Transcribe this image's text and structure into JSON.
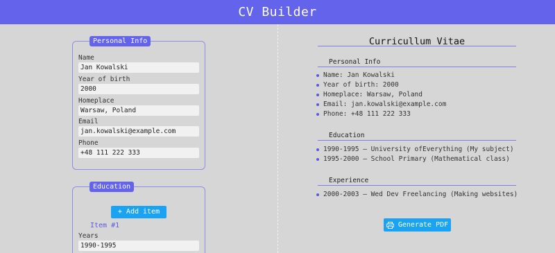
{
  "app": {
    "title": "CV Builder"
  },
  "form": {
    "personal": {
      "legend": "Personal Info",
      "fields": [
        {
          "label": "Name",
          "value": "Jan Kowalski"
        },
        {
          "label": "Year of birth",
          "value": "2000"
        },
        {
          "label": "Homeplace",
          "value": "Warsaw, Poland"
        },
        {
          "label": "Email",
          "value": "jan.kowalski@example.com"
        },
        {
          "label": "Phone",
          "value": "+48 111 222 333"
        }
      ]
    },
    "education": {
      "legend": "Education",
      "add_item_label": "+ Add item",
      "item_title": "Item #1",
      "years_label": "Years",
      "years_value": "1990-1995"
    }
  },
  "preview": {
    "title": "Curricullum Vitae",
    "personal": {
      "title": "Personal Info",
      "items": [
        "Name: Jan Kowalski",
        "Year of birth: 2000",
        "Homeplace: Warsaw, Poland",
        "Email: jan.kowalski@example.com",
        "Phone: +48 111 222 333"
      ]
    },
    "education": {
      "title": "Education",
      "items": [
        "1990-1995 — University ofEverything (My subject)",
        "1995-2000 — School Primary (Mathematical class)"
      ]
    },
    "experience": {
      "title": "Experience",
      "items": [
        "2000-2003 — Wed Dev Freelancing (Making websites)"
      ]
    },
    "generate_label": "Generate PDF"
  },
  "icons": {
    "generate": "printer-icon"
  },
  "colors": {
    "accent": "#6363ec",
    "button": "#1aa3f3",
    "background": "#d6d6d6"
  }
}
